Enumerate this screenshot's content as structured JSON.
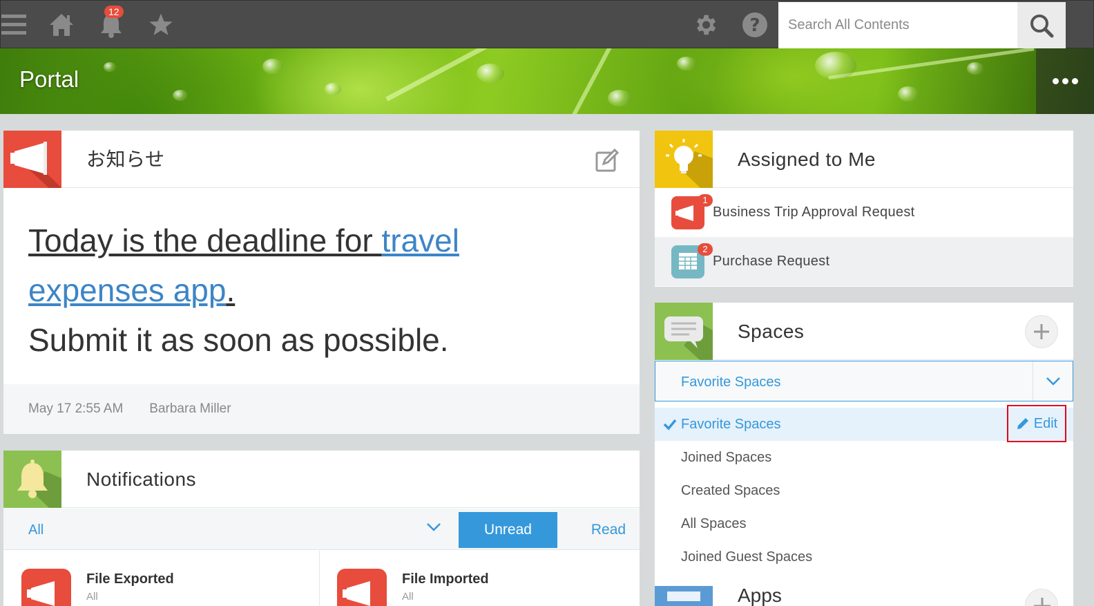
{
  "topbar": {
    "notification_count": "12",
    "search_placeholder": "Search All Contents"
  },
  "banner": {
    "title": "Portal"
  },
  "announcement": {
    "title": "お知らせ",
    "line1_prefix": "Today is the deadline for ",
    "link_text_1": "travel",
    "link_text_2": "expenses app",
    "line2_suffix": ".",
    "line3": "Submit it as soon as possible.",
    "date": "May 17 2:55 AM",
    "author": "Barbara Miller"
  },
  "notifications": {
    "title": "Notifications",
    "filter_value": "All",
    "unread_label": "Unread",
    "read_label": "Read",
    "cards": [
      {
        "title": "File Exported",
        "subtitle": "All"
      },
      {
        "title": "File Imported",
        "subtitle": "All"
      }
    ]
  },
  "assigned": {
    "title": "Assigned to Me",
    "items": [
      {
        "label": "Business Trip Approval Request",
        "count": "1"
      },
      {
        "label": "Purchase Request",
        "count": "2"
      }
    ]
  },
  "spaces": {
    "title": "Spaces",
    "selected": "Favorite Spaces",
    "edit_label": "Edit",
    "options": [
      {
        "label": "Favorite Spaces"
      },
      {
        "label": "Joined Spaces"
      },
      {
        "label": "Created Spaces"
      },
      {
        "label": "All Spaces"
      },
      {
        "label": "Joined Guest Spaces"
      }
    ]
  },
  "apps": {
    "title": "Apps"
  },
  "colors": {
    "accent": "#3498db",
    "badge": "#e74c3c",
    "highlight_box": "#e3001b"
  }
}
